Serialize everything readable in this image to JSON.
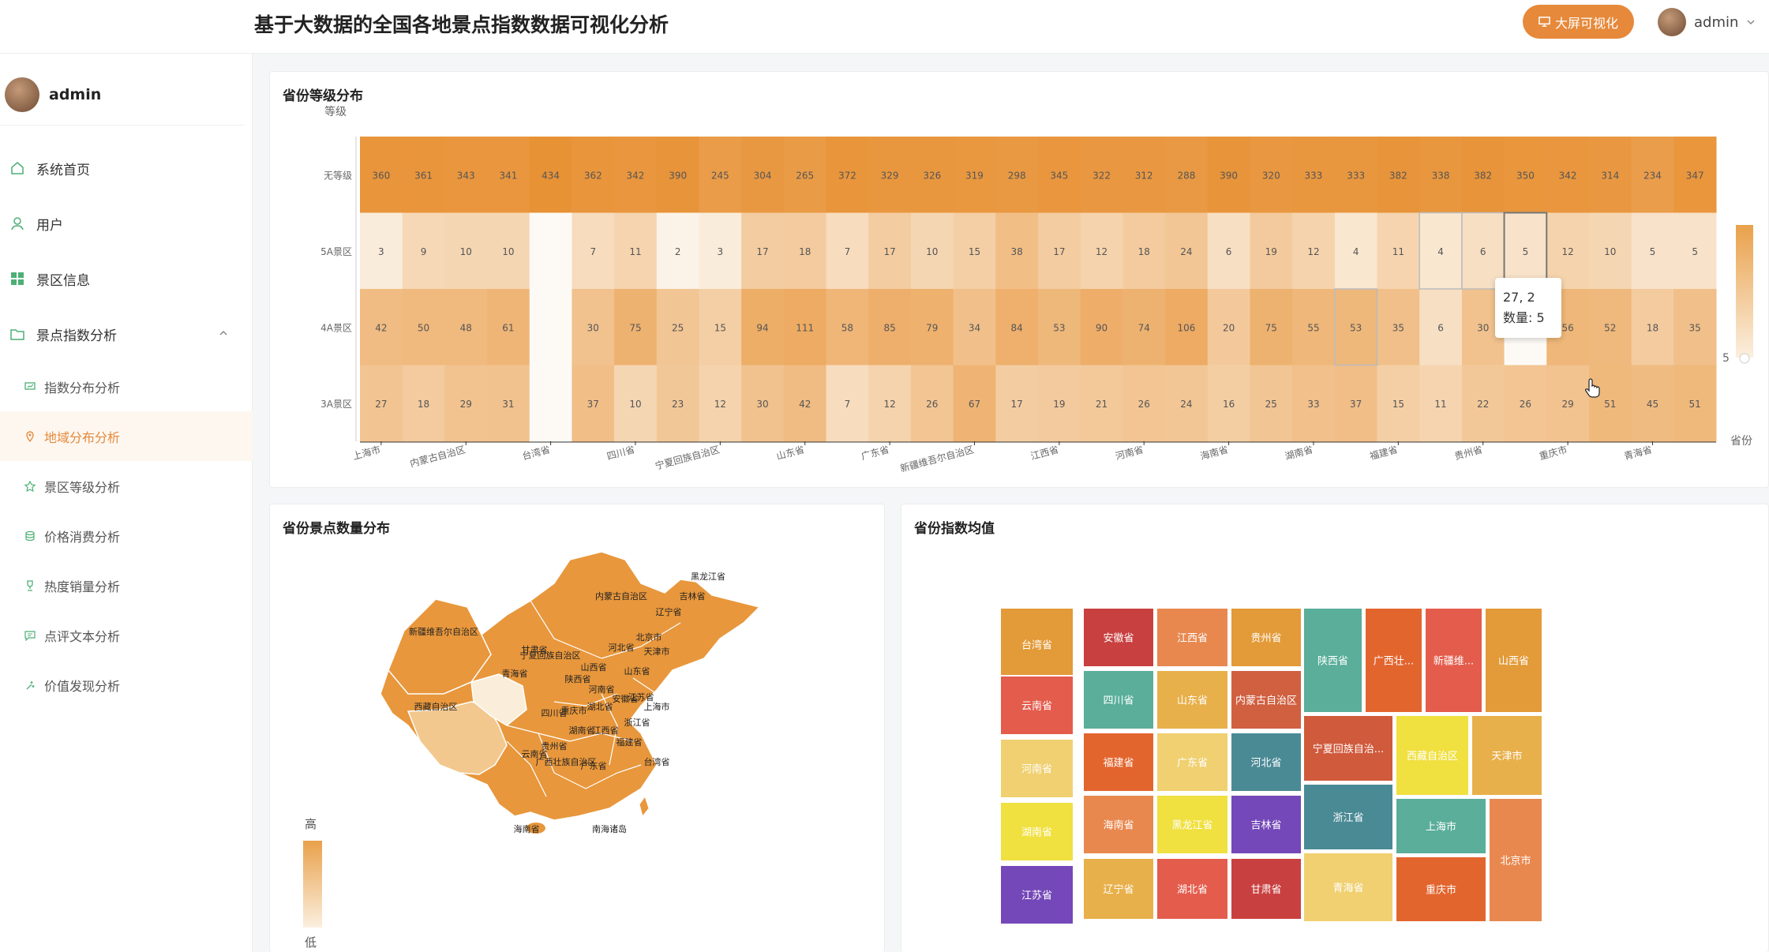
{
  "header": {
    "title": "基于大数据的全国各地景点指数数据可视化分析",
    "big_screen_label": "大屏可视化",
    "username": "admin"
  },
  "sidebar": {
    "username": "admin",
    "items": [
      {
        "label": "系统首页",
        "icon": "home-icon"
      },
      {
        "label": "用户",
        "icon": "user-icon"
      },
      {
        "label": "景区信息",
        "icon": "grid-icon"
      },
      {
        "label": "景点指数分析",
        "icon": "folder-icon"
      }
    ],
    "subitems": [
      {
        "label": "指数分布分析",
        "icon": "chart-icon"
      },
      {
        "label": "地域分布分析",
        "icon": "location-icon",
        "active": true
      },
      {
        "label": "景区等级分析",
        "icon": "star-icon"
      },
      {
        "label": "价格消费分析",
        "icon": "coins-icon"
      },
      {
        "label": "热度销量分析",
        "icon": "trophy-icon"
      },
      {
        "label": "点评文本分析",
        "icon": "comment-icon"
      },
      {
        "label": "价值发现分析",
        "icon": "sparkle-icon"
      }
    ]
  },
  "heatmap_card": {
    "title": "省份等级分布"
  },
  "tooltip": {
    "line1": "27, 2",
    "line2": "数量:  5"
  },
  "map_card": {
    "title": "省份景点数量分布",
    "legend_high": "高",
    "legend_low": "低",
    "labels": [
      "黑龙江省",
      "吉林省",
      "辽宁省",
      "内蒙古自治区",
      "新疆维吾尔自治区",
      "甘肃省",
      "宁夏回族自治区",
      "青海省",
      "西藏自治区",
      "四川省",
      "重庆市",
      "陕西省",
      "山西省",
      "河北省",
      "北京市",
      "天津市",
      "山东省",
      "河南省",
      "湖北省",
      "安徽省",
      "江苏省",
      "上海市",
      "浙江省",
      "湖南省",
      "江西省",
      "福建省",
      "台湾省",
      "贵州省",
      "云南省",
      "广西壮族自治区",
      "广东省",
      "海南省",
      "南海诸岛"
    ]
  },
  "treemap_card": {
    "title": "省份指数均值"
  },
  "chart_data": [
    {
      "type": "heatmap",
      "title": "省份等级分布",
      "ylabel": "等级",
      "xlabel": "省份",
      "y_categories": [
        "无等级",
        "5A景区",
        "4A景区",
        "3A景区"
      ],
      "x_tick_labels": [
        "上海市",
        "内蒙古自治区",
        "台湾省",
        "四川省",
        "宁夏回族自治区",
        "山东省",
        "广东省",
        "新疆维吾尔自治区",
        "江西省",
        "河南省",
        "海南省",
        "湖南省",
        "福建省",
        "贵州省",
        "重庆市",
        "青海省"
      ],
      "visual_map": {
        "max_label": "",
        "min_label": "5"
      },
      "rows": [
        [
          "360",
          "361",
          "343",
          "341",
          "434",
          "362",
          "342",
          "390",
          "245",
          "304",
          "265",
          "372",
          "329",
          "326",
          "319",
          "298",
          "345",
          "322",
          "312",
          "288",
          "390",
          "320",
          "333",
          "333",
          "382",
          "338",
          "382",
          "350",
          "342",
          "314",
          "234",
          "347"
        ],
        [
          "3",
          "9",
          "10",
          "10",
          "",
          "7",
          "11",
          "2",
          "3",
          "17",
          "18",
          "7",
          "17",
          "10",
          "15",
          "38",
          "17",
          "12",
          "18",
          "24",
          "6",
          "19",
          "12",
          "4",
          "11",
          "4",
          "6",
          "5",
          "12",
          "10",
          "5",
          "5"
        ],
        [
          "42",
          "50",
          "48",
          "61",
          "",
          "30",
          "75",
          "25",
          "15",
          "94",
          "111",
          "58",
          "85",
          "79",
          "34",
          "84",
          "53",
          "90",
          "74",
          "106",
          "20",
          "75",
          "55",
          "53",
          "35",
          "6",
          "30",
          "",
          "56",
          "52",
          "18",
          "35"
        ],
        [
          "27",
          "18",
          "29",
          "31",
          "",
          "37",
          "10",
          "23",
          "12",
          "30",
          "42",
          "7",
          "12",
          "26",
          "67",
          "17",
          "19",
          "21",
          "26",
          "24",
          "16",
          "25",
          "33",
          "37",
          "15",
          "11",
          "22",
          "26",
          "29",
          "51",
          "45",
          "51"
        ]
      ]
    },
    {
      "type": "map",
      "title": "省份景点数量分布"
    },
    {
      "type": "treemap",
      "title": "省份指数均值",
      "nodes": [
        "台湾省",
        "安徽省",
        "江西省",
        "贵州省",
        "陕西省",
        "广西壮...",
        "新疆维...",
        "山西省",
        "云南省",
        "四川省",
        "山东省",
        "内蒙古自治区",
        "宁夏回族自治...",
        "西藏自治区",
        "天津市",
        "河南省",
        "福建省",
        "广东省",
        "河北省",
        "浙江省",
        "上海市",
        "湖南省",
        "海南省",
        "黑龙江省",
        "吉林省",
        "青海省",
        "重庆市",
        "北京市",
        "江苏省",
        "辽宁省",
        "湖北省",
        "甘肃省"
      ]
    }
  ]
}
